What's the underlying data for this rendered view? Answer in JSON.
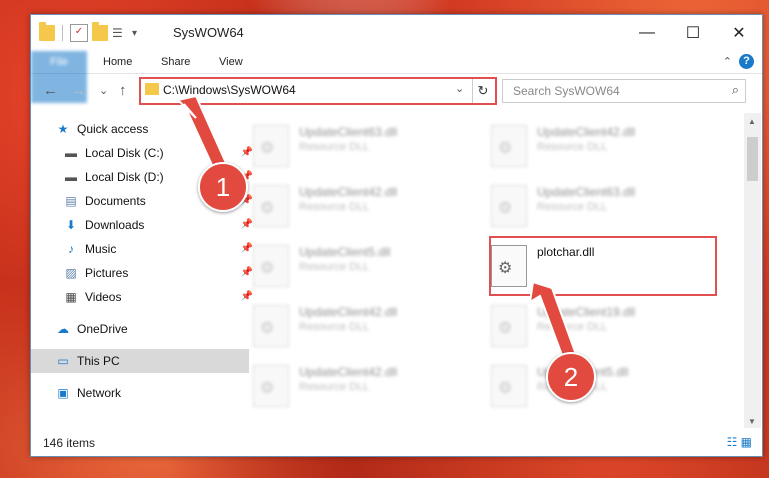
{
  "window": {
    "title": "SysWOW64",
    "minimize": "—",
    "maximize": "☐",
    "close": "✕"
  },
  "ribbon": {
    "tabs": [
      "File",
      "Home",
      "Share",
      "View"
    ],
    "help": "?",
    "collapse": "⌃"
  },
  "address": {
    "path": "C:\\Windows\\SysWOW64",
    "dropdown": "⌄",
    "refresh": "↻"
  },
  "search": {
    "placeholder": "Search SysWOW64",
    "icon": "⌕"
  },
  "navigation": {
    "back": "←",
    "forward": "→",
    "recent": "⌄",
    "up": "↑"
  },
  "sidebar": {
    "items": [
      {
        "label": "Quick access",
        "icon": "star-icon",
        "glyph": "★",
        "color": "#1979ca",
        "pinned": false
      },
      {
        "label": "Local Disk (C:)",
        "icon": "drive-icon",
        "glyph": "▬",
        "color": "#555555",
        "pinned": true
      },
      {
        "label": "Local Disk (D:)",
        "icon": "drive-icon",
        "glyph": "▬",
        "color": "#555555",
        "pinned": true
      },
      {
        "label": "Documents",
        "icon": "documents-icon",
        "glyph": "▤",
        "color": "#5a7ea8",
        "pinned": true
      },
      {
        "label": "Downloads",
        "icon": "download-icon",
        "glyph": "⬇",
        "color": "#1979ca",
        "pinned": true
      },
      {
        "label": "Music",
        "icon": "music-icon",
        "glyph": "♪",
        "color": "#1979ca",
        "pinned": true
      },
      {
        "label": "Pictures",
        "icon": "pictures-icon",
        "glyph": "▨",
        "color": "#5a7ea8",
        "pinned": true
      },
      {
        "label": "Videos",
        "icon": "videos-icon",
        "glyph": "▦",
        "color": "#444444",
        "pinned": true
      },
      {
        "label": "OneDrive",
        "icon": "cloud-icon",
        "glyph": "☁",
        "color": "#1979ca",
        "pinned": false
      },
      {
        "label": "This PC",
        "icon": "computer-icon",
        "glyph": "▭",
        "color": "#1979ca",
        "pinned": false
      },
      {
        "label": "Network",
        "icon": "network-icon",
        "glyph": "▣",
        "color": "#1979ca",
        "pinned": false
      }
    ]
  },
  "files": [
    {
      "name": "UpdateClient63.dll",
      "type": "Resource DLL"
    },
    {
      "name": "UpdateClient42.dll",
      "type": "Resource DLL"
    },
    {
      "name": "UpdateClient42.dll",
      "type": "Resource DLL"
    },
    {
      "name": "UpdateClient63.dll",
      "type": "Resource DLL"
    },
    {
      "name": "UpdateClient5.dll",
      "type": "Resource DLL"
    },
    {
      "name": "plotchar.dll",
      "type": ""
    },
    {
      "name": "UpdateClient42.dll",
      "type": "Resource DLL"
    },
    {
      "name": "UpdateClient19.dll",
      "type": "Resource DLL"
    },
    {
      "name": "UpdateClient42.dll",
      "type": "Resource DLL"
    },
    {
      "name": "UpdateClient5.dll",
      "type": "Resource DLL"
    }
  ],
  "status": {
    "count": "146 items"
  },
  "annotations": {
    "step1": "1",
    "step2": "2",
    "color": "#e24a40"
  }
}
